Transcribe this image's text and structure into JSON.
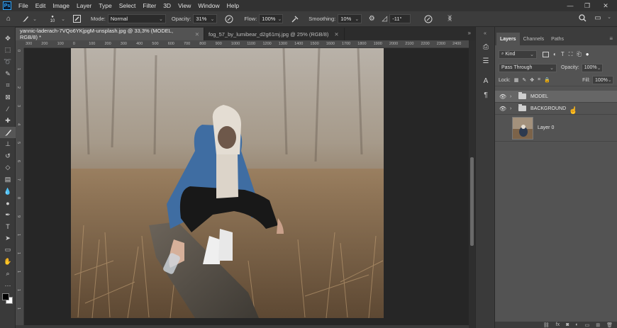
{
  "app": {
    "logo": "Ps"
  },
  "menu": [
    "File",
    "Edit",
    "Image",
    "Layer",
    "Type",
    "Select",
    "Filter",
    "3D",
    "View",
    "Window",
    "Help"
  ],
  "window_controls": {
    "minimize": "—",
    "restore": "❐",
    "close": "✕"
  },
  "options": {
    "brush_size": "10",
    "mode_label": "Mode:",
    "mode_value": "Normal",
    "opacity_label": "Opacity:",
    "opacity_value": "31%",
    "flow_label": "Flow:",
    "flow_value": "100%",
    "smoothing_label": "Smoothing:",
    "smoothing_value": "10%",
    "angle_value": "-11°"
  },
  "documents": [
    {
      "title": "yannic-laderach-7VQo6YKjpgM-unsplash.jpg @ 33,3% (MODEL, RGB/8) *",
      "active": true
    },
    {
      "title": "fog_57_by_lumibear_d2g61mj.jpg @ 25% (RGB/8)",
      "active": false
    }
  ],
  "ruler": {
    "top": [
      "300",
      "200",
      "100",
      "0",
      "100",
      "200",
      "300",
      "400",
      "500",
      "600",
      "700",
      "800",
      "900",
      "1000",
      "1100",
      "1200",
      "1300",
      "1400",
      "1500",
      "1600",
      "1700",
      "1800",
      "1900",
      "2000",
      "2100",
      "2200",
      "2300",
      "2400"
    ],
    "left": [
      "0",
      "1",
      "2",
      "3",
      "4",
      "5",
      "6",
      "7",
      "8",
      "9",
      "1",
      "1",
      "1",
      "1",
      "1"
    ]
  },
  "panels": {
    "tabs": [
      "Layers",
      "Channels",
      "Paths"
    ],
    "kind_label": "Kind",
    "blend_mode": "Pass Through",
    "opacity_label": "Opacity:",
    "opacity_value": "100%",
    "lock_label": "Lock:",
    "fill_label": "Fill:",
    "fill_value": "100%"
  },
  "layers": [
    {
      "name": "MODEL",
      "type": "group",
      "visible": true,
      "selected": true
    },
    {
      "name": "BACKGROUND",
      "type": "group",
      "visible": true,
      "selected": false
    },
    {
      "name": "Layer 0",
      "type": "image",
      "visible": false,
      "selected": false
    }
  ],
  "colors": {
    "accent": "#31a8ff",
    "menubar": "#323232",
    "panel": "#535353",
    "canvas_bg": "#262626"
  },
  "icons": {
    "tools": [
      "move-icon",
      "marquee-icon",
      "lasso-icon",
      "quick-select-icon",
      "crop-icon",
      "frame-icon",
      "eyedropper-icon",
      "healing-icon",
      "brush-icon",
      "clone-stamp-icon",
      "history-brush-icon",
      "eraser-icon",
      "gradient-icon",
      "blur-icon",
      "dodge-icon",
      "pen-icon",
      "type-icon",
      "path-select-icon",
      "rectangle-icon",
      "hand-icon",
      "zoom-icon",
      "more-icon"
    ]
  }
}
